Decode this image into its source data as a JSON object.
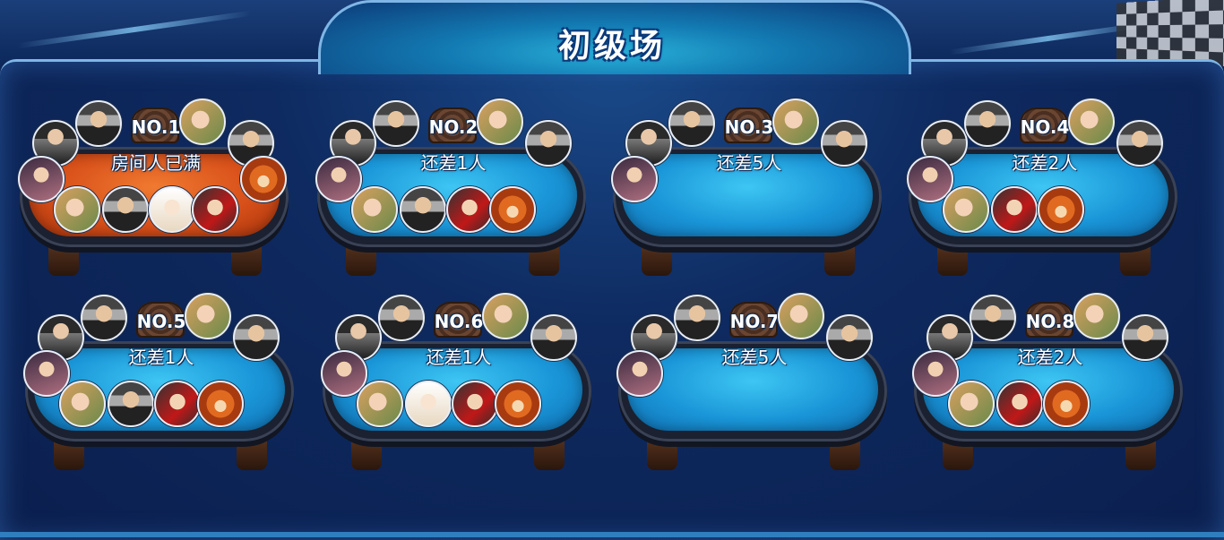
{
  "header": {
    "title": "初级场"
  },
  "rooms": [
    {
      "number": "NO.1",
      "status": "房间人已满",
      "full": true,
      "avatars": [
        "m1",
        "m2",
        "w1",
        "m2",
        "w2",
        "w1",
        "m2",
        "bright",
        "w3",
        "fox"
      ]
    },
    {
      "number": "NO.2",
      "status": "还差1人",
      "full": false,
      "avatars": [
        "m1",
        "m2",
        "w1",
        "m2",
        "w2",
        "w1",
        "m2",
        "w3",
        "fox"
      ]
    },
    {
      "number": "NO.3",
      "status": "还差5人",
      "full": false,
      "avatars": [
        "m1",
        "m2",
        "w1",
        "m2",
        "w2"
      ]
    },
    {
      "number": "NO.4",
      "status": "还差2人",
      "full": false,
      "avatars": [
        "m1",
        "m2",
        "w1",
        "m2",
        "w2",
        "w1",
        "w3",
        "fox"
      ]
    },
    {
      "number": "NO.5",
      "status": "还差1人",
      "full": false,
      "avatars": [
        "m1",
        "m2",
        "w1",
        "m2",
        "w2",
        "w1",
        "m2",
        "w3",
        "fox"
      ]
    },
    {
      "number": "NO.6",
      "status": "还差1人",
      "full": false,
      "avatars": [
        "m1",
        "m2",
        "w1",
        "m2",
        "w2",
        "w1",
        "bright",
        "w3",
        "fox"
      ]
    },
    {
      "number": "NO.7",
      "status": "还差5人",
      "full": false,
      "avatars": [
        "m1",
        "m2",
        "w1",
        "m2",
        "w2"
      ]
    },
    {
      "number": "NO.8",
      "status": "还差2人",
      "full": false,
      "avatars": [
        "m1",
        "m2",
        "w1",
        "m2",
        "w2",
        "w1",
        "w3",
        "fox"
      ]
    }
  ]
}
